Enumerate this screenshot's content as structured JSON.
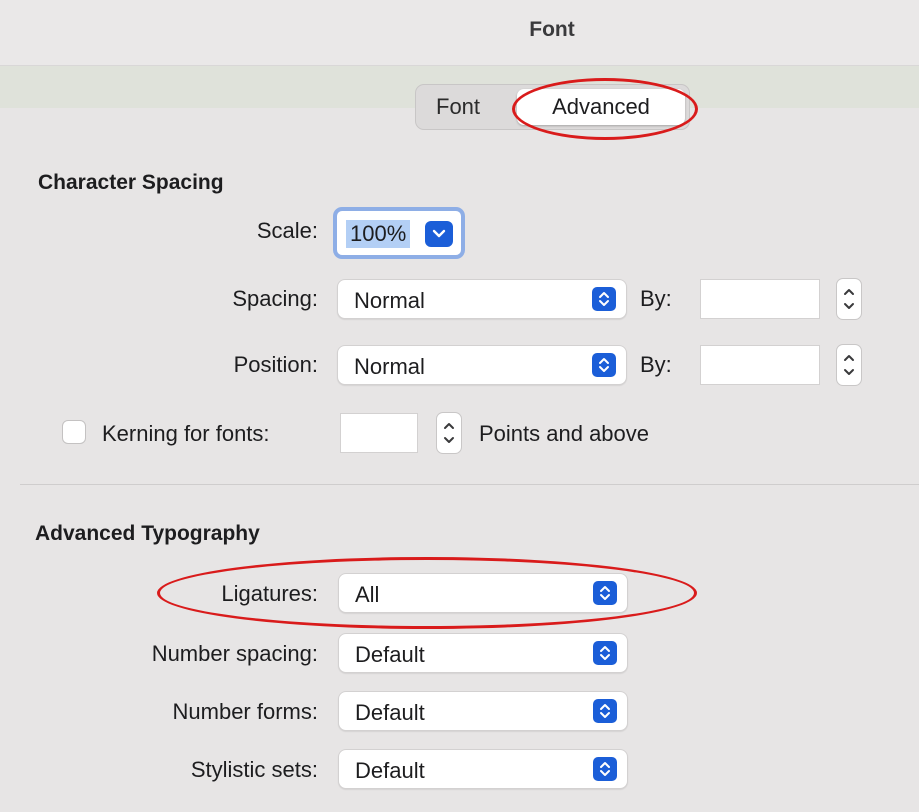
{
  "window": {
    "title": "Font"
  },
  "tabs": [
    {
      "label": "Font",
      "selected": false
    },
    {
      "label": "Advanced",
      "selected": true
    }
  ],
  "character_spacing": {
    "heading": "Character Spacing",
    "scale": {
      "label": "Scale:",
      "value": "100%"
    },
    "spacing": {
      "label": "Spacing:",
      "value": "Normal",
      "by_label": "By:",
      "by_value": ""
    },
    "position": {
      "label": "Position:",
      "value": "Normal",
      "by_label": "By:",
      "by_value": ""
    },
    "kerning": {
      "label": "Kerning for fonts:",
      "checked": false,
      "value": "",
      "suffix": "Points and above"
    }
  },
  "advanced_typography": {
    "heading": "Advanced Typography",
    "ligatures": {
      "label": "Ligatures:",
      "value": "All"
    },
    "number_spacing": {
      "label": "Number spacing:",
      "value": "Default"
    },
    "number_forms": {
      "label": "Number forms:",
      "value": "Default"
    },
    "stylistic_sets": {
      "label": "Stylistic sets:",
      "value": "Default"
    }
  },
  "colors": {
    "accent": "#1b5ed8",
    "annotation": "#d91b1b",
    "selection": "#b3cff5"
  }
}
